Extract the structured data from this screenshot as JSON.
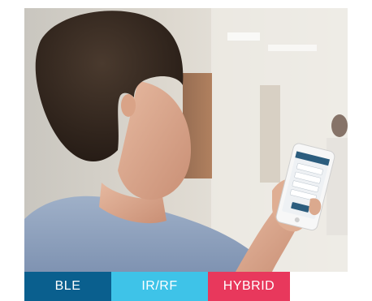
{
  "labels": [
    {
      "text": "BLE",
      "color": "#0a5f8e"
    },
    {
      "text": "IR/RF",
      "color": "#3ec3e8"
    },
    {
      "text": "HYBRID",
      "color": "#e8385c"
    }
  ],
  "photo": {
    "subject": "person holding smartphone",
    "phone_menu_items": [
      "",
      "",
      "",
      ""
    ]
  }
}
